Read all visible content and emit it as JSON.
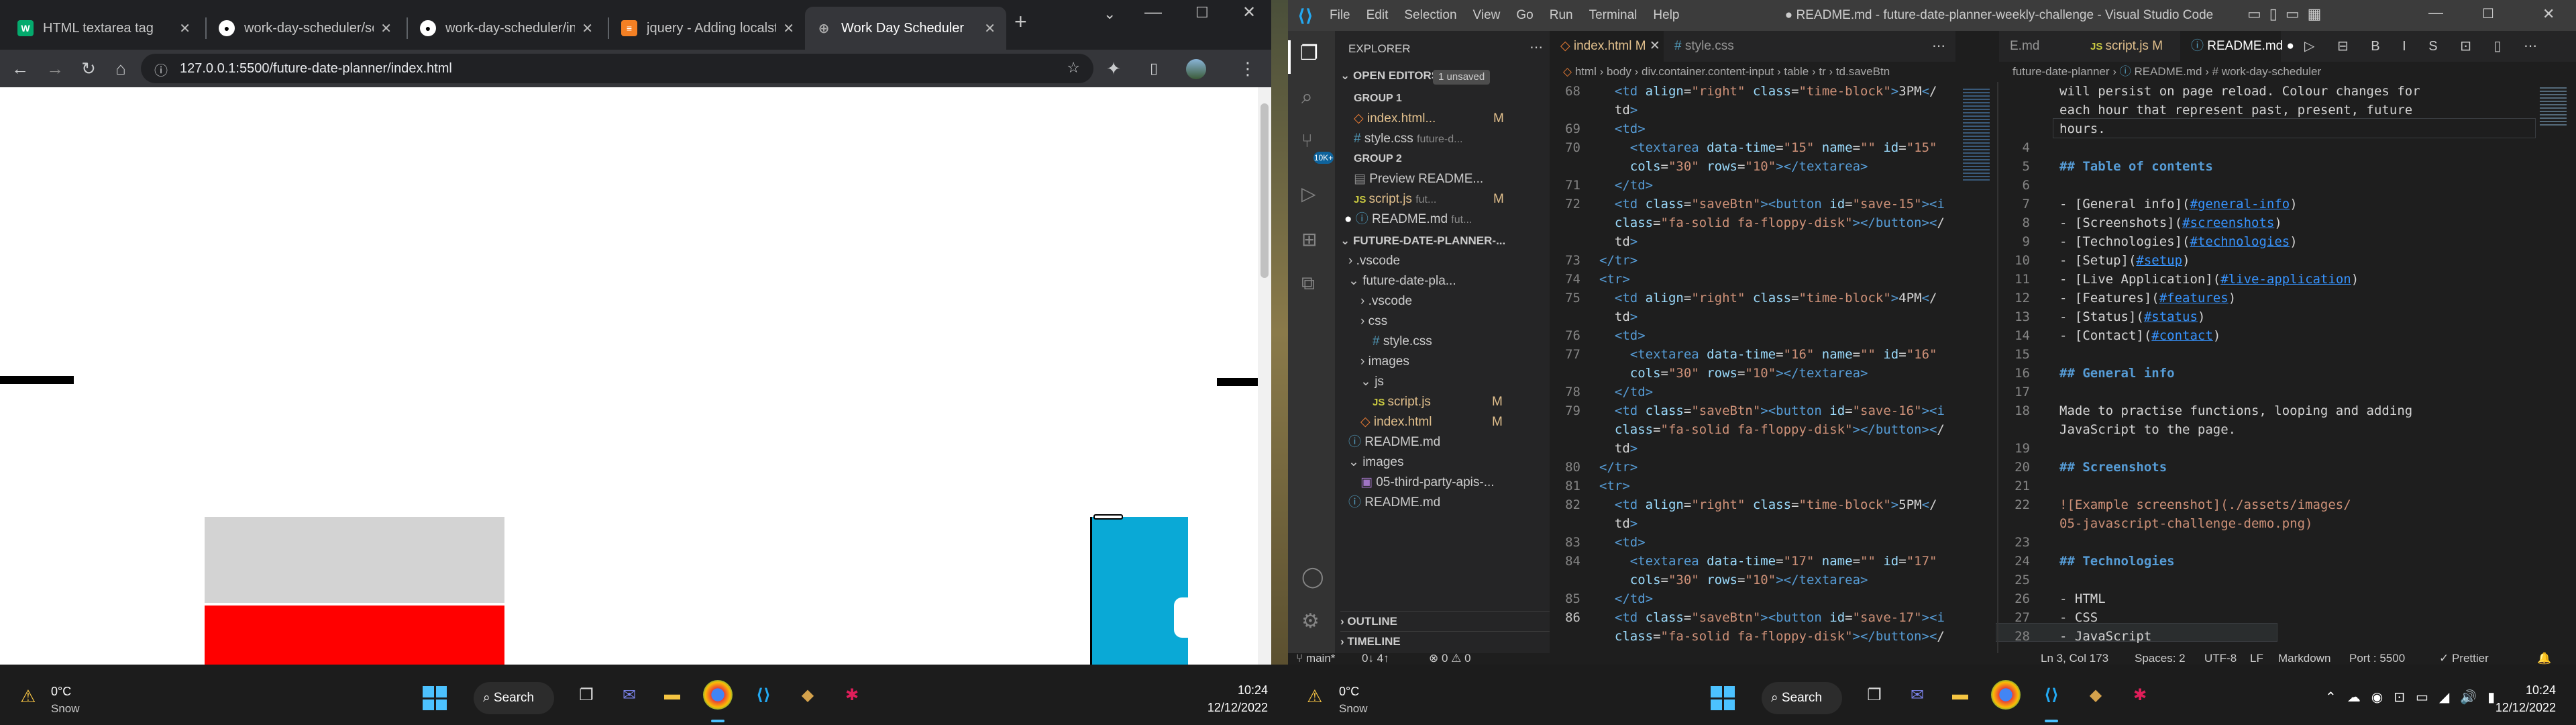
{
  "chrome": {
    "tabs": [
      {
        "label": "HTML textarea tag",
        "favicon": "w3schools-icon"
      },
      {
        "label": "work-day-scheduler/script",
        "favicon": "github-icon"
      },
      {
        "label": "work-day-scheduler/inde",
        "favicon": "github-icon"
      },
      {
        "label": "jquery - Adding localsto",
        "favicon": "stackoverflow-icon"
      },
      {
        "label": "Work Day Scheduler",
        "favicon": "globe-icon"
      }
    ],
    "url": "127.0.0.1:5500/future-date-planner/index.html",
    "colors": {
      "gray_block": "#d3d3d3",
      "red_block": "#ff0000",
      "blue_block": "#0aa9d6"
    }
  },
  "vscode": {
    "menu": [
      "File",
      "Edit",
      "Selection",
      "View",
      "Go",
      "Run",
      "Terminal",
      "Help"
    ],
    "title": "● README.md - future-date-planner-weekly-challenge - Visual Studio Code",
    "explorer": {
      "header": "EXPLORER",
      "open_editors": "OPEN EDITORS",
      "unsaved_badge": "1 unsaved",
      "group1": "GROUP 1",
      "group1_items": [
        {
          "name": "index.html...",
          "status": "M"
        },
        {
          "name": "style.css",
          "detail": "future-d..."
        }
      ],
      "group2": "GROUP 2",
      "group2_items": [
        {
          "name": "Preview README..."
        },
        {
          "name": "script.js",
          "detail": "fut...",
          "status": "M"
        },
        {
          "name": "README.md",
          "detail": "fut..."
        }
      ],
      "root": "FUTURE-DATE-PLANNER-...",
      "tree": [
        {
          "name": ".vscode",
          "kind": "folder",
          "depth": 0
        },
        {
          "name": "future-date-pla...",
          "kind": "folder",
          "depth": 0
        },
        {
          "name": ".vscode",
          "kind": "folder",
          "depth": 1
        },
        {
          "name": "css",
          "kind": "folder",
          "depth": 1
        },
        {
          "name": "style.css",
          "kind": "css",
          "depth": 2
        },
        {
          "name": "images",
          "kind": "folder",
          "depth": 1
        },
        {
          "name": "js",
          "kind": "folder",
          "depth": 1
        },
        {
          "name": "script.js",
          "kind": "js",
          "depth": 2,
          "status": "M"
        },
        {
          "name": "index.html",
          "kind": "html",
          "depth": 1,
          "status": "M"
        },
        {
          "name": "README.md",
          "kind": "md",
          "depth": 0
        },
        {
          "name": "images",
          "kind": "folder",
          "depth": 0
        },
        {
          "name": "05-third-party-apis-...",
          "kind": "img",
          "depth": 1
        },
        {
          "name": "README.md",
          "kind": "md",
          "depth": 0
        }
      ],
      "outline": "OUTLINE",
      "timeline": "TIMELINE"
    },
    "left_tabs": [
      {
        "label": "index.html",
        "status": "M"
      },
      {
        "label": "style.css"
      }
    ],
    "left_breadcrumb": [
      "html",
      "body",
      "div.container.content-input",
      "table",
      "tr",
      "td.saveBtn"
    ],
    "right_tabs": [
      {
        "label": "E.md"
      },
      {
        "label": "script.js",
        "status": "M"
      },
      {
        "label": "README.md"
      }
    ],
    "right_breadcrumb": [
      "future-date-planner",
      "README.md",
      "# work-day-scheduler"
    ],
    "left_code": [
      {
        "n": "68",
        "text": "  <td align=\"right\" class=\"time-block\">3PM</"
      },
      {
        "n": "",
        "text": "  td>"
      },
      {
        "n": "69",
        "text": "  <td>"
      },
      {
        "n": "70",
        "text": "    <textarea data-time=\"15\" name=\"\" id=\"15\""
      },
      {
        "n": "",
        "text": "    cols=\"30\" rows=\"10\"></textarea>"
      },
      {
        "n": "71",
        "text": "  </td>"
      },
      {
        "n": "72",
        "text": "  <td class=\"saveBtn\"><button id=\"save-15\"><i"
      },
      {
        "n": "",
        "text": "  class=\"fa-solid fa-floppy-disk\"></button></"
      },
      {
        "n": "",
        "text": "  td>"
      },
      {
        "n": "73",
        "text": "</tr>"
      },
      {
        "n": "74",
        "text": "<tr>"
      },
      {
        "n": "75",
        "text": "  <td align=\"right\" class=\"time-block\">4PM</"
      },
      {
        "n": "",
        "text": "  td>"
      },
      {
        "n": "76",
        "text": "  <td>"
      },
      {
        "n": "77",
        "text": "    <textarea data-time=\"16\" name=\"\" id=\"16\""
      },
      {
        "n": "",
        "text": "    cols=\"30\" rows=\"10\"></textarea>"
      },
      {
        "n": "78",
        "text": "  </td>"
      },
      {
        "n": "79",
        "text": "  <td class=\"saveBtn\"><button id=\"save-16\"><i"
      },
      {
        "n": "",
        "text": "  class=\"fa-solid fa-floppy-disk\"></button></"
      },
      {
        "n": "",
        "text": "  td>"
      },
      {
        "n": "80",
        "text": "</tr>"
      },
      {
        "n": "81",
        "text": "<tr>"
      },
      {
        "n": "82",
        "text": "  <td align=\"right\" class=\"time-block\">5PM</"
      },
      {
        "n": "",
        "text": "  td>"
      },
      {
        "n": "83",
        "text": "  <td>"
      },
      {
        "n": "84",
        "text": "    <textarea data-time=\"17\" name=\"\" id=\"17\""
      },
      {
        "n": "",
        "text": "    cols=\"30\" rows=\"10\"></textarea>"
      },
      {
        "n": "85",
        "text": "  </td>"
      },
      {
        "n": "86",
        "text": "  <td class=\"saveBtn\"><button id=\"save-17\"><i"
      },
      {
        "n": "",
        "text": "  class=\"fa-solid fa-floppy-disk\"></button></"
      }
    ],
    "right_code": [
      {
        "n": "",
        "text": "will persist on page reload. Colour changes for",
        "kind": "txt"
      },
      {
        "n": "",
        "text": "each hour that represent past, present, future",
        "kind": "txt"
      },
      {
        "n": "",
        "text": "hours.",
        "kind": "txt"
      },
      {
        "n": "4",
        "text": "",
        "kind": "txt"
      },
      {
        "n": "5",
        "text": "## Table of contents",
        "kind": "h"
      },
      {
        "n": "6",
        "text": "",
        "kind": "txt"
      },
      {
        "n": "7",
        "text": "- [General info](#general-info)",
        "kind": "li"
      },
      {
        "n": "8",
        "text": "- [Screenshots](#screenshots)",
        "kind": "li"
      },
      {
        "n": "9",
        "text": "- [Technologies](#technologies)",
        "kind": "li"
      },
      {
        "n": "10",
        "text": "- [Setup](#setup)",
        "kind": "li"
      },
      {
        "n": "11",
        "text": "- [Live Application](#live-application)",
        "kind": "li"
      },
      {
        "n": "12",
        "text": "- [Features](#features)",
        "kind": "li"
      },
      {
        "n": "13",
        "text": "- [Status](#status)",
        "kind": "li"
      },
      {
        "n": "14",
        "text": "- [Contact](#contact)",
        "kind": "li"
      },
      {
        "n": "15",
        "text": "",
        "kind": "txt"
      },
      {
        "n": "16",
        "text": "## General info",
        "kind": "h"
      },
      {
        "n": "17",
        "text": "",
        "kind": "txt"
      },
      {
        "n": "18",
        "text": "Made to practise functions, looping and adding",
        "kind": "txt"
      },
      {
        "n": "",
        "text": "JavaScript to the page.",
        "kind": "txt"
      },
      {
        "n": "19",
        "text": "",
        "kind": "txt"
      },
      {
        "n": "20",
        "text": "## Screenshots",
        "kind": "h"
      },
      {
        "n": "21",
        "text": "",
        "kind": "txt"
      },
      {
        "n": "22",
        "text": "![Example screenshot](./assets/images/",
        "kind": "img"
      },
      {
        "n": "",
        "text": "05-javascript-challenge-demo.png)",
        "kind": "img"
      },
      {
        "n": "23",
        "text": "",
        "kind": "txt"
      },
      {
        "n": "24",
        "text": "## Technologies",
        "kind": "h"
      },
      {
        "n": "25",
        "text": "",
        "kind": "txt"
      },
      {
        "n": "26",
        "text": "- HTML",
        "kind": "txt"
      },
      {
        "n": "27",
        "text": "- CSS",
        "kind": "txt"
      },
      {
        "n": "28",
        "text": "- JavaScript",
        "kind": "txt"
      }
    ],
    "status": {
      "branch": "main*",
      "sync": "0↓ 4↑",
      "problems": "⊗ 0 ⚠ 0",
      "position": "Ln 3, Col 173",
      "spaces": "Spaces: 2",
      "encoding": "UTF-8",
      "eol": "LF",
      "language": "Markdown",
      "port": "Port : 5500",
      "prettier": "✓ Prettier"
    }
  },
  "taskbar": {
    "weather_left": {
      "temp": "0°C",
      "cond": "Snow"
    },
    "weather_right": {
      "temp": "0°C",
      "cond": "Snow"
    },
    "search": "Search",
    "time": "10:24",
    "date": "12/12/2022"
  }
}
